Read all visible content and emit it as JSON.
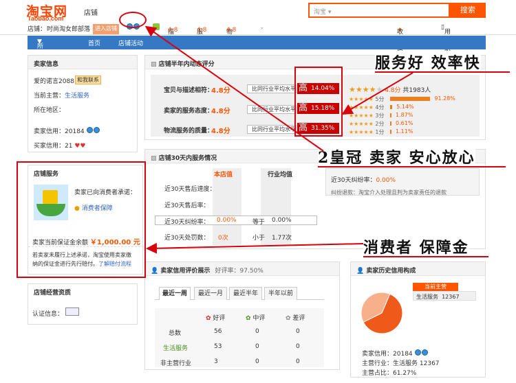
{
  "header": {
    "logo": "淘宝网",
    "logo_sub": "Taobao.com",
    "store_label": "店铺",
    "search_scope": "淘宝",
    "search_btn": "搜索"
  },
  "infobar": {
    "store_label": "店铺：",
    "store_name": "时尚淘女郎部落",
    "enter_btn": "进入店铺",
    "desc_label": "描述",
    "desc_score": "4.8",
    "service_label": "服务",
    "service_score": "4.8",
    "logistics_label": "物流",
    "logistics_score": "4.8",
    "fav": "收藏店铺",
    "mobile": "用手机逛本店"
  },
  "nav": {
    "all": "所有分类",
    "home": "首页",
    "events": "店铺活动"
  },
  "seller": {
    "title": "卖家信息",
    "name": "爱的诺言2088",
    "contact": "和我联系",
    "main_label": "当前主营：",
    "main_value": "生活服务",
    "region_label": "所在地区：",
    "seller_credit_label": "卖家信用：",
    "seller_credit": "20184",
    "buyer_credit_label": "买家信用：",
    "buyer_credit": "21"
  },
  "service": {
    "title": "店铺服务",
    "promise": "卖家已向消费者承诺：",
    "guarantee": "消费者保障",
    "deposit_label": "卖家当前保证金余额",
    "deposit": "￥1,000.00 元",
    "note1": "若卖家未履行上述承诺，淘宝使用卖家缴",
    "note2": "纳的保证金进行先行赔付。",
    "link": "了解赔付流程"
  },
  "biz": {
    "title": "店铺经营资质",
    "auth": "认证信息："
  },
  "ratings": {
    "title": "店铺半年内动态评分",
    "rows": [
      {
        "label": "宝贝与描述相符：",
        "score": "4.8分",
        "cmp": "比同行业平均水平",
        "level": "高",
        "pct": "14.04%"
      },
      {
        "label": "卖家的服务态度：",
        "score": "4.8分",
        "cmp": "比同行业平均水平",
        "level": "高",
        "pct": "15.18%"
      },
      {
        "label": "物流服务的质量：",
        "score": "4.8分",
        "cmp": "比同行业平均水平",
        "level": "高",
        "pct": "31.35%"
      }
    ],
    "avg": "4.8分",
    "total": "共1983人",
    "dist": [
      {
        "label": "5分",
        "pct": "91.28%",
        "frac": 0.9128
      },
      {
        "label": "4分",
        "pct": "5.14%",
        "frac": 0.0514
      },
      {
        "label": "3分",
        "pct": "1.87%",
        "frac": 0.0187
      },
      {
        "label": "2分",
        "pct": "0.61%",
        "frac": 0.0061
      },
      {
        "label": "1分",
        "pct": "1.11%",
        "frac": 0.0111
      }
    ]
  },
  "svc30": {
    "title": "店铺30天内服务情况",
    "col1": "本店值",
    "col2": "行业均值",
    "rows": [
      "近30天售后速度：",
      "近30天售后率：",
      "近30天纠纷率：",
      "近30天处罚数："
    ],
    "dispute_store": "0.00%",
    "dispute_cmp": "等于",
    "dispute_avg": "0.00%",
    "penalty_store": "0次",
    "penalty_cmp": "小于",
    "penalty_avg": "1.77次",
    "side_title": "近30天纠纷率：",
    "side_val": "0.00%",
    "side_desc": "纠纷退款：淘宝介入处理且判为卖家责任的退款"
  },
  "credit": {
    "title": "卖家信用评价展示",
    "rate_label": "好评率：",
    "rate": "97.50%",
    "tabs": [
      "最近一周",
      "最近一月",
      "最近半年",
      "半年以前"
    ],
    "cols": [
      "好评",
      "中评",
      "差评"
    ],
    "rows": [
      {
        "name": "总数",
        "v": [
          "56",
          "0",
          "0"
        ]
      },
      {
        "name": "生活服务",
        "v": [
          "53",
          "0",
          "0"
        ]
      },
      {
        "name": "非主营行业",
        "v": [
          "3",
          "0",
          "0"
        ]
      }
    ]
  },
  "history": {
    "title": "卖家历史信用构成",
    "tag": "当前主营",
    "tag_cat": "生活服务",
    "tag_val": "12367",
    "credit_label": "卖家信用：",
    "credit": "20184",
    "main_label": "主营行业：",
    "main_cat": "生活服务",
    "main_val": "12367",
    "ratio_label": "主营占比：",
    "ratio": "61.27%",
    "chart_data": {
      "type": "pie",
      "categories": [
        "生活服务",
        "其他"
      ],
      "values": [
        61.27,
        38.73
      ]
    }
  },
  "annotations": {
    "a1": "服务好  效率快",
    "a2": "2皇冠 卖家 安心放心",
    "a3": "消费者 保障金"
  },
  "colors": {
    "accent": "#ff5500",
    "nav": "#3578c4",
    "annotation": "#d8000d"
  }
}
